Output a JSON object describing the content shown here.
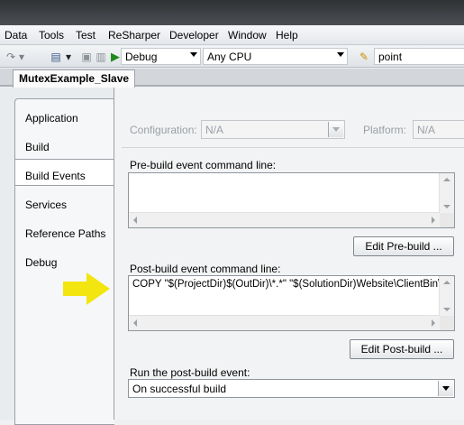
{
  "menu": [
    "Data",
    "Tools",
    "Test",
    "ReSharper",
    "Developer",
    "Window",
    "Help"
  ],
  "toolbar": {
    "configuration": "Debug",
    "platform": "Any CPU",
    "find": "point"
  },
  "document_tab": "MutexExample_Slave",
  "nav": {
    "items": [
      "Application",
      "Build",
      "Build Events",
      "Services",
      "Reference Paths",
      "Debug"
    ],
    "selected": "Build Events"
  },
  "config": {
    "configuration_label": "Configuration:",
    "configuration_value": "N/A",
    "platform_label": "Platform:",
    "platform_value": "N/A"
  },
  "prebuild": {
    "label": "Pre-build event command line:",
    "value": "",
    "edit_button": "Edit Pre-build ..."
  },
  "postbuild": {
    "label": "Post-build event command line:",
    "value": "COPY \"$(ProjectDir)$(OutDir)\\*.*\" \"$(SolutionDir)Website\\ClientBin\\\"",
    "edit_button": "Edit Post-build ..."
  },
  "run": {
    "label": "Run the post-build event:",
    "value": "On successful build"
  },
  "colors": {
    "arrow": "#f3e510",
    "title_bar": "#3a3d40"
  }
}
